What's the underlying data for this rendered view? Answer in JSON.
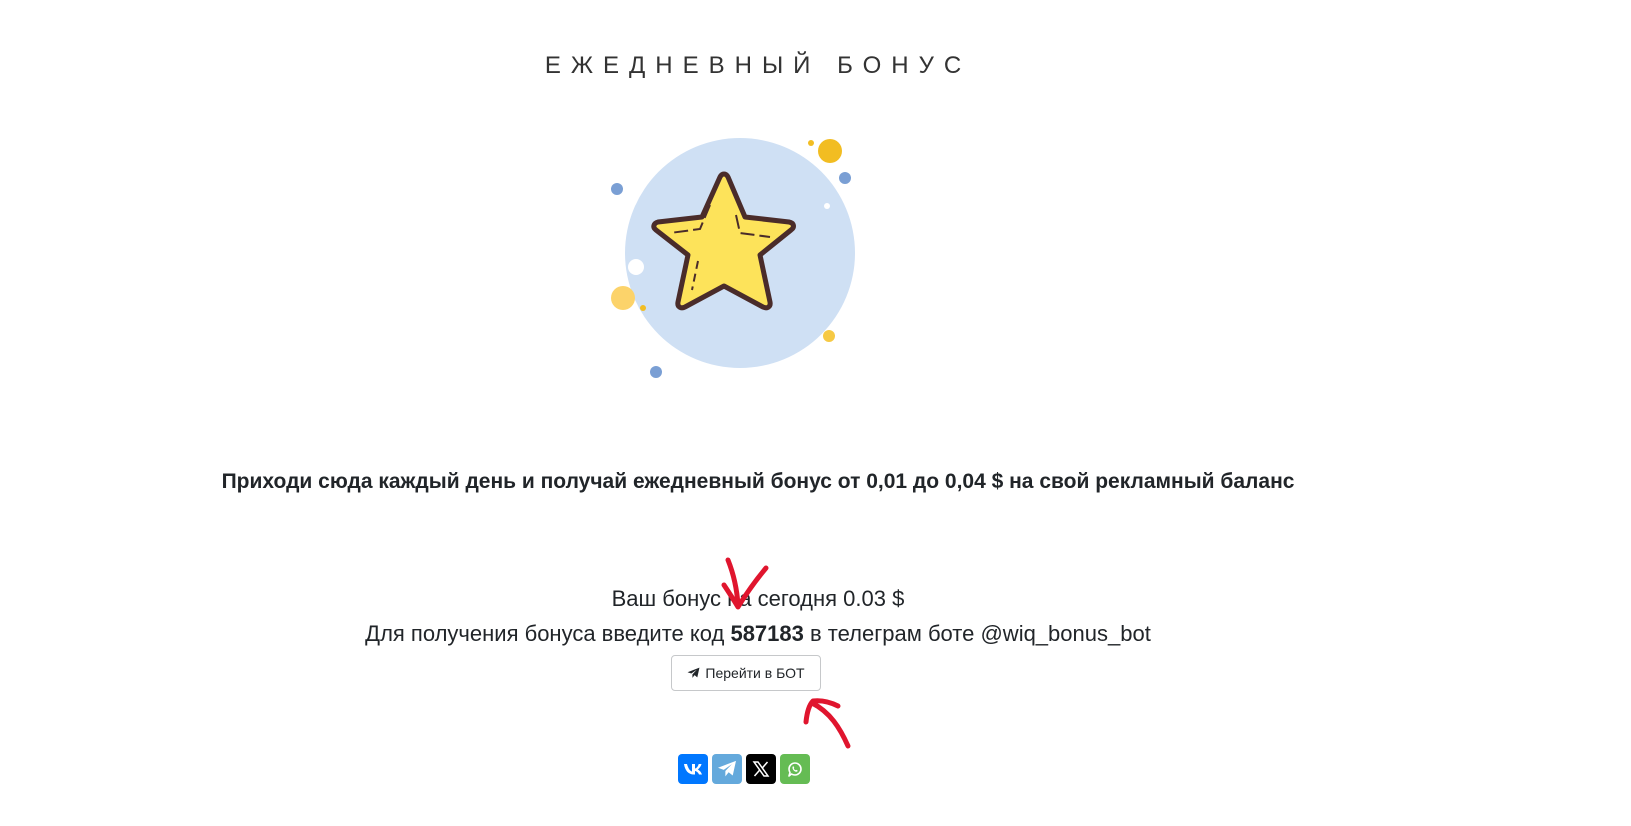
{
  "header": {
    "title": "ЕЖЕДНЕВНЫЙ БОНУС"
  },
  "promo": {
    "text": "Приходи сюда каждый день и получай ежедневный бонус от 0,01 до 0,04 $ на свой рекламный баланс"
  },
  "bonus": {
    "today_text": "Ваш бонус на сегодня 0.03 $",
    "code_prefix": "Для получения бонуса введите код",
    "code": "587183",
    "code_suffix": "в телеграм боте @wiq_bonus_bot"
  },
  "bot_button": {
    "label": "Перейти в БОТ",
    "icon": "telegram-plane-icon"
  },
  "share": {
    "buttons": [
      {
        "icon": "vk-icon",
        "color": "#0077ff"
      },
      {
        "icon": "telegram-icon",
        "color": "#64a9dc"
      },
      {
        "icon": "x-icon",
        "color": "#000000"
      },
      {
        "icon": "whatsapp-icon",
        "color": "#65bc54"
      }
    ]
  },
  "colors": {
    "star_fill": "#fde35a",
    "circle_bg": "#cfe0f4",
    "annotation_red": "#e0152e"
  }
}
